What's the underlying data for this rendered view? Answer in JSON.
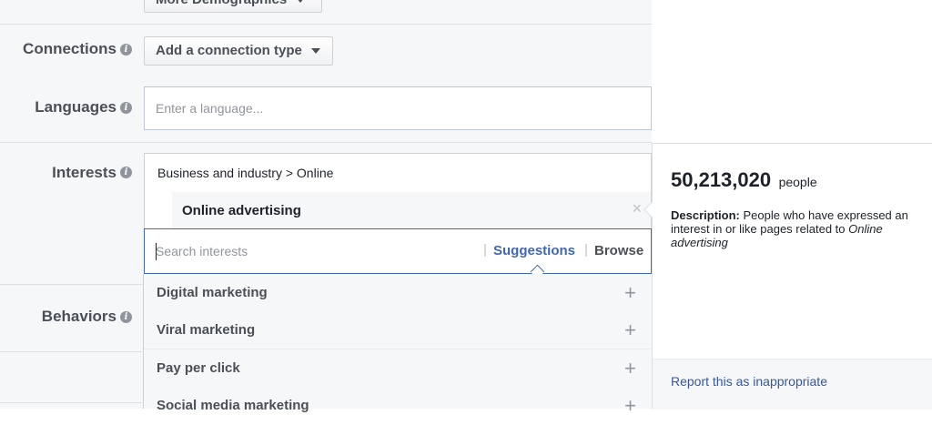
{
  "demographics": {
    "button_label": "More Demographics"
  },
  "connections": {
    "label": "Connections",
    "button_label": "Add a connection type"
  },
  "languages": {
    "label": "Languages",
    "placeholder": "Enter a language..."
  },
  "interests": {
    "label": "Interests",
    "path": "Business and industry > Online",
    "selected": "Online advertising",
    "remove_glyph": "×",
    "search_placeholder": "Search interests",
    "suggestions_label": "Suggestions",
    "browse_label": "Browse",
    "separator": "|",
    "suggestions": [
      {
        "label": "Digital marketing"
      },
      {
        "label": "Viral marketing"
      },
      {
        "label": "Pay per click"
      },
      {
        "label": "Social media marketing"
      }
    ],
    "add_glyph": "+"
  },
  "behaviors": {
    "label": "Behaviors"
  },
  "info_glyph": "i",
  "audience_panel": {
    "count": "50,213,020",
    "unit": "people",
    "description_label": "Description:",
    "description_text": " People who have expressed an interest in or like pages related to ",
    "description_topic": "Online advertising",
    "report_link": "Report this as inappropriate"
  },
  "colors": {
    "accent": "#4267b2",
    "link": "#365899",
    "border": "#dddfe2",
    "background": "#f6f7f9"
  }
}
